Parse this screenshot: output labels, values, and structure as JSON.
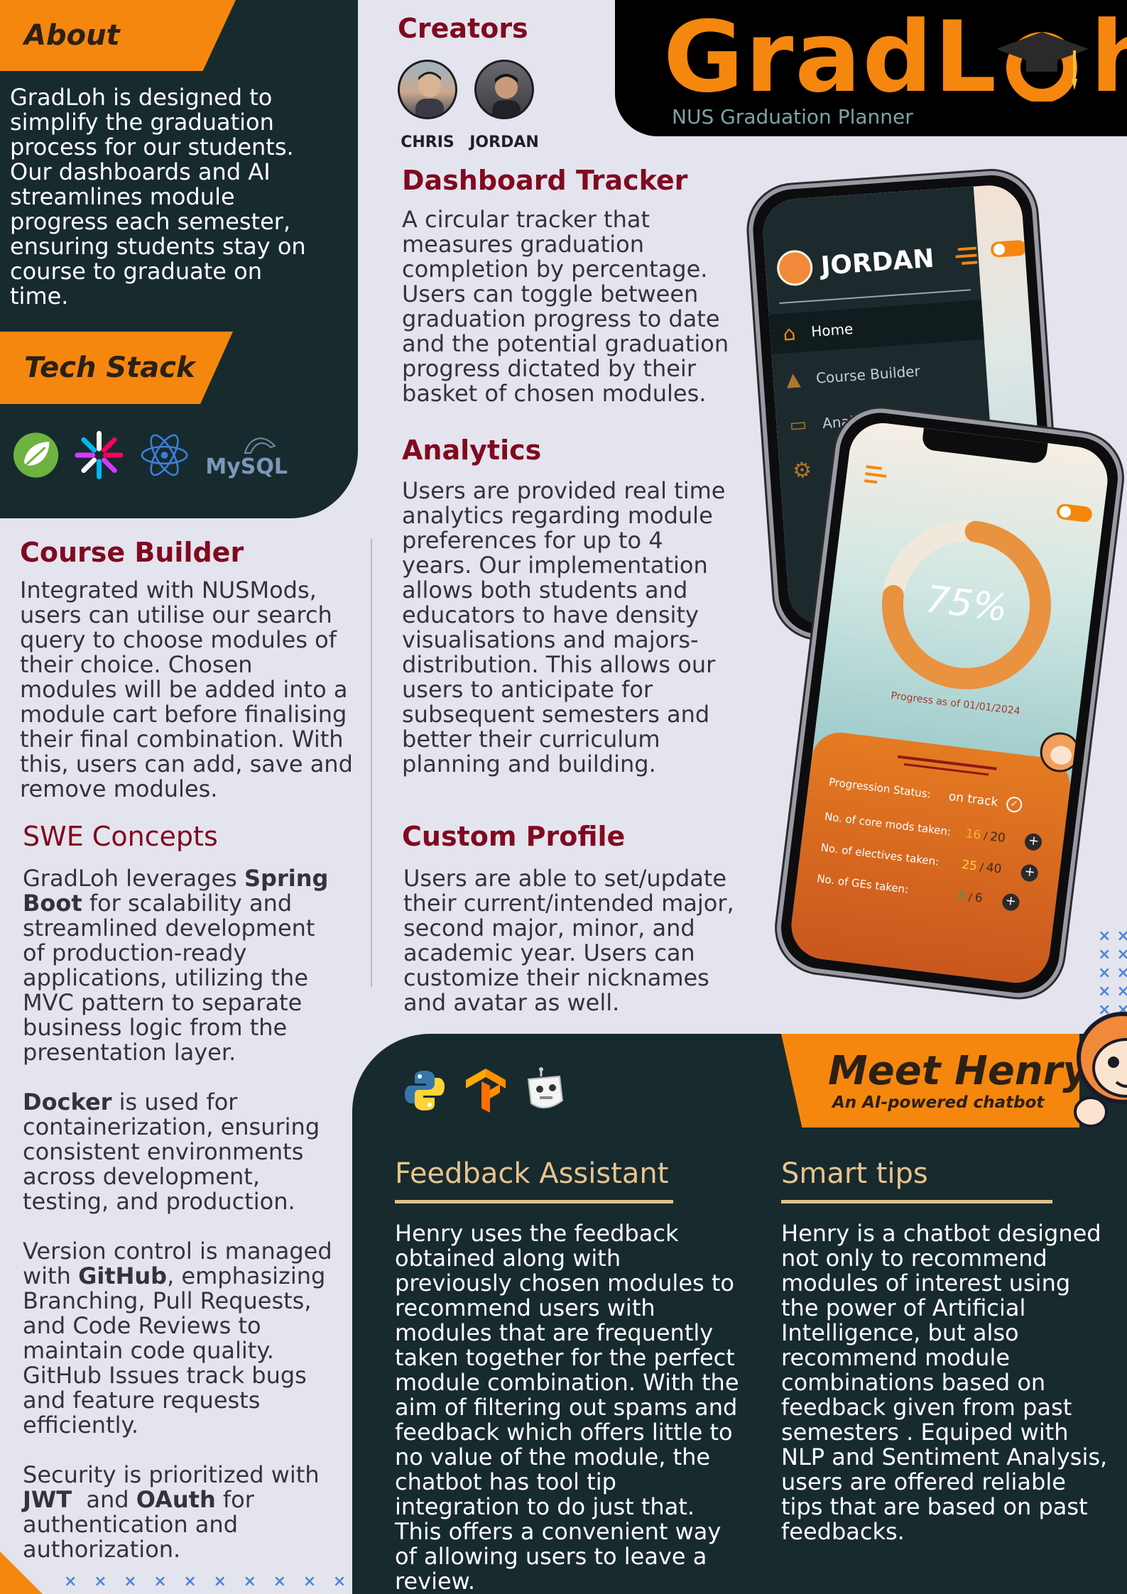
{
  "about": {
    "heading": "About",
    "text": "GradLoh is designed to simplify the graduation process for our students. Our dashboards and AI streamlines module progress each semester, ensuring students stay on course to graduate on time."
  },
  "tech_stack": {
    "heading": "Tech Stack",
    "icons": [
      "spring-icon",
      "jwt-icon",
      "react-icon",
      "mysql-icon"
    ],
    "mysql_label": "MySQL"
  },
  "brand": {
    "name_part1": "GradL",
    "name_part2": "h",
    "subtitle": "NUS Graduation Planner",
    "color": "#f5870f"
  },
  "creators": {
    "heading": "Creators",
    "people": [
      {
        "name": "CHRIS"
      },
      {
        "name": "JORDAN"
      }
    ]
  },
  "dashboard_tracker": {
    "heading": "Dashboard Tracker",
    "text": "A circular tracker that measures graduation completion by percentage. Users can toggle between graduation progress to date and the potential graduation progress dictated by their basket of chosen modules."
  },
  "analytics": {
    "heading": "Analytics",
    "text": "Users are provided real time analytics regarding module preferences for up to 4 years. Our implementation allows both students and educators to have density visualisations and majors-distribution. This allows our users to anticipate for subsequent semesters and better their curriculum planning and building."
  },
  "custom_profile": {
    "heading": "Custom Profile",
    "text": "Users are able to set/update their current/intended major, second major, minor, and academic year. Users can customize their nicknames and avatar as well."
  },
  "course_builder": {
    "heading": "Course Builder",
    "text": "Integrated with NUSMods, users can utilise our search query to choose modules of their choice. Chosen modules will be added into a module cart before finalising their final combination. With this, users can add, save and remove modules."
  },
  "swe_concepts": {
    "heading": "SWE Concepts",
    "p1_pre": "GradLoh leverages ",
    "p1_bold": "Spring Boot",
    "p1_post": " for scalability and streamlined development of production-ready applications, utilizing the MVC pattern to separate business logic from the presentation layer.",
    "p2_bold": "Docker",
    "p2_post": " is used for containerization, ensuring consistent environments across development, testing, and production.",
    "p3_pre": "Version control is managed with ",
    "p3_bold": "GitHub",
    "p3_post": ", emphasizing Branching, Pull Requests, and Code Reviews to maintain code quality. GitHub Issues track bugs and feature requests efficiently.",
    "p4_pre": "Security is prioritized with ",
    "p4_bold1": "JWT",
    "p4_mid": "  and ",
    "p4_bold2": "OAuth",
    "p4_post": " for authentication and authorization."
  },
  "phone_back": {
    "user": "JORDAN",
    "menu": [
      {
        "label": "Home",
        "icon": "home-icon"
      },
      {
        "label": "Course Builder",
        "icon": "graduation-cap-icon"
      },
      {
        "label": "Analytics",
        "icon": "book-icon"
      },
      {
        "label": "",
        "icon": "gear-icon"
      }
    ]
  },
  "phone_front": {
    "progress_percent": "75%",
    "progress_value": 0.75,
    "progress_date": "Progress as of 01/01/2024",
    "status_label": "Progression Status:",
    "status_value": "on track",
    "rows": [
      {
        "label": "No. of core mods taken:",
        "taken": "16",
        "total": "20",
        "color": "#f5b335"
      },
      {
        "label": "No. of electives taken:",
        "taken": "25",
        "total": "40",
        "color": "#f5d13a"
      },
      {
        "label": "No. of GEs taken:",
        "taken": "6",
        "total": "6",
        "color": "#3c9a5a"
      }
    ]
  },
  "henry": {
    "title": "Meet Henry",
    "subtitle": "An AI-powered chatbot",
    "icons": [
      "python-icon",
      "tensorflow-icon",
      "robot-icon"
    ],
    "feedback": {
      "heading": "Feedback Assistant",
      "text": "Henry uses the feedback obtained along with previously chosen modules  to recommend users with modules that are frequently taken together for the perfect module combination. With the aim of filtering out spams and feedback which offers little to no value of the module, the chatbot has tool tip integration to do just that. This offers a convenient way of allowing users to leave a review."
    },
    "tips": {
      "heading": "Smart tips",
      "text": "Henry is a chatbot designed not only to recommend modules of interest using the power of Artificial Intelligence, but also recommend module combinations based on feedback given from past semesters . Equiped with NLP and Sentiment Analysis, users are offered reliable tips that are based on past feedbacks."
    }
  }
}
